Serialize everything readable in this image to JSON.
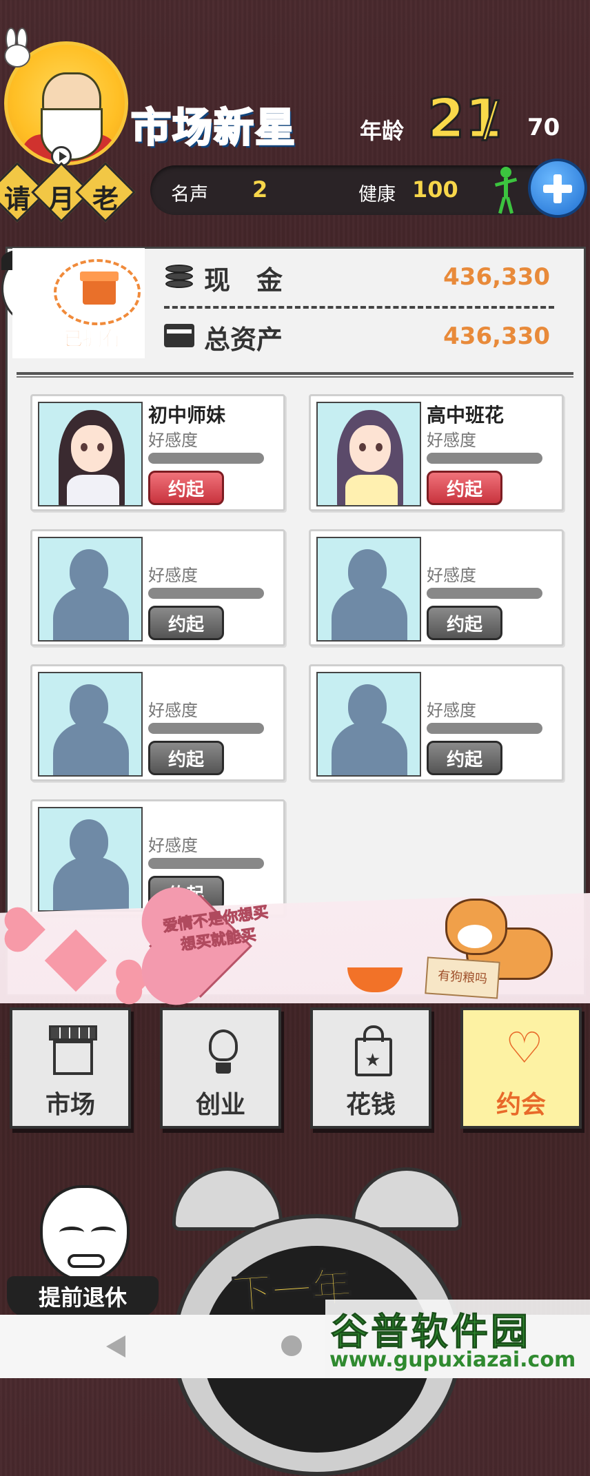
{
  "header": {
    "title": "市场新星",
    "age_label": "年龄",
    "age_value": "21",
    "age_separator": "/",
    "age_max": "70",
    "ask_chars": [
      "请",
      "月",
      "老"
    ],
    "fame_label": "名声",
    "fame_value": "2",
    "health_label": "健康",
    "health_value": "100"
  },
  "finance": {
    "owned_label": "已拥有",
    "cash_label": "现　金",
    "cash_value": "436,330",
    "assets_label": "总资产",
    "assets_value": "436,330"
  },
  "girls": [
    {
      "name": "初中师妹",
      "favor_label": "好感度",
      "favor": 0,
      "button": "约起",
      "unlocked": true,
      "hair": "#3a2a30",
      "outfit": "#f1f1f7"
    },
    {
      "name": "高中班花",
      "favor_label": "好感度",
      "favor": 0,
      "button": "约起",
      "unlocked": true,
      "hair": "#5b4a6a",
      "outfit": "#fff0b0"
    },
    {
      "name": "",
      "favor_label": "好感度",
      "favor": 0,
      "button": "约起",
      "unlocked": false
    },
    {
      "name": "",
      "favor_label": "好感度",
      "favor": 0,
      "button": "约起",
      "unlocked": false
    },
    {
      "name": "",
      "favor_label": "好感度",
      "favor": 0,
      "button": "约起",
      "unlocked": false
    },
    {
      "name": "",
      "favor_label": "好感度",
      "favor": 0,
      "button": "约起",
      "unlocked": false
    },
    {
      "name": "",
      "favor_label": "好感度",
      "favor": 0,
      "button": "约起",
      "unlocked": false
    }
  ],
  "banner": {
    "slogan_line1": "爱情不是你想买",
    "slogan_line2": "想买就能买",
    "dog_sign": "有狗粮吗"
  },
  "bottom_nav": [
    {
      "label": "市场",
      "icon": "shop-icon",
      "active": false
    },
    {
      "label": "创业",
      "icon": "lightbulb-icon",
      "active": false
    },
    {
      "label": "花钱",
      "icon": "shopping-bag-icon",
      "active": false
    },
    {
      "label": "约会",
      "icon": "heart-icon",
      "active": true
    }
  ],
  "actions": {
    "retire_label": "提前退休",
    "next_year_label": "下一年"
  },
  "watermark": {
    "title": "谷普软件园",
    "url": "www.gupuxiazai.com"
  },
  "colors": {
    "accent_orange": "#e88a3a",
    "gold": "#f7d64a",
    "active_nav_bg": "#fdf2a3",
    "button_red": "#d8434c"
  }
}
